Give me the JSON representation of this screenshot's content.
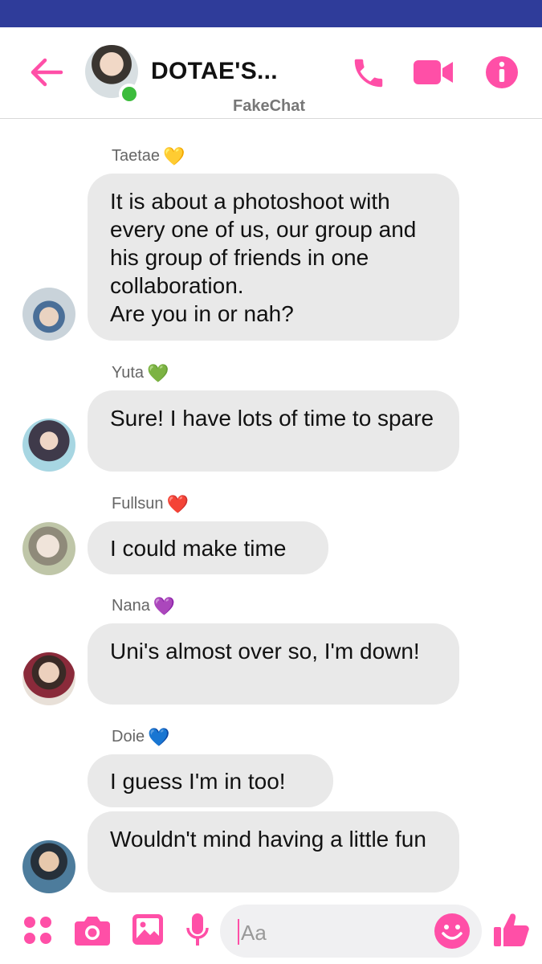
{
  "colors": {
    "accent": "#ff4fa7",
    "status_bar": "#2f3c9a",
    "bubble": "#e9e9e9",
    "online": "#3cbc3c"
  },
  "header": {
    "title": "DOTAE'S...",
    "subtitle": "FakeChat",
    "icons": [
      "back-arrow-icon",
      "phone-icon",
      "video-camera-icon",
      "info-icon"
    ]
  },
  "messages": [
    {
      "sender": "Taetae",
      "heart": "💛",
      "texts": [
        "It is about a photoshoot with every one of us, our group and his group of friends in one collaboration.\nAre you in or nah?"
      ]
    },
    {
      "sender": "Yuta",
      "heart": "💚",
      "texts": [
        "Sure!  I have lots of time to spare"
      ]
    },
    {
      "sender": "Fullsun",
      "heart": "❤️",
      "texts": [
        "I could make time"
      ]
    },
    {
      "sender": "Nana",
      "heart": "💜",
      "texts": [
        "Uni's almost over so,  I'm down!"
      ]
    },
    {
      "sender": "Doie",
      "heart": "💙",
      "texts": [
        "I guess I'm in too!",
        "Wouldn't mind having a little fun"
      ]
    }
  ],
  "composer": {
    "placeholder": "Aa",
    "icons": [
      "apps-grid-icon",
      "camera-icon",
      "image-icon",
      "microphone-icon",
      "emoji-icon",
      "thumbs-up-icon"
    ]
  }
}
